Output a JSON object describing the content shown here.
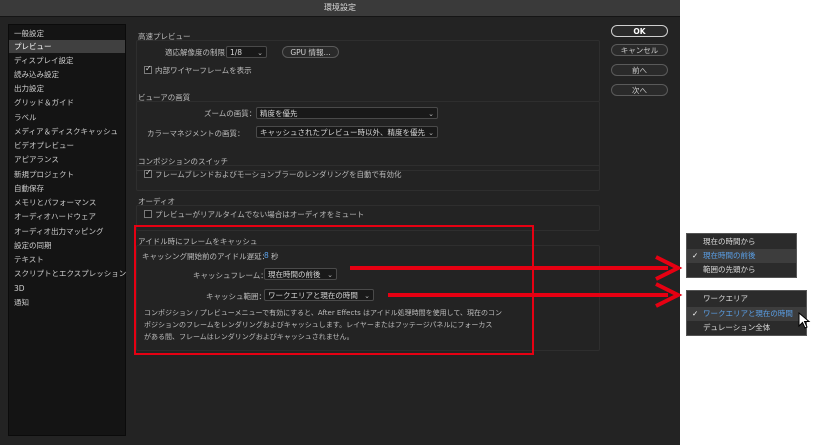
{
  "window": {
    "title": "環境設定"
  },
  "sidebar": {
    "items": [
      "一般設定",
      "プレビュー",
      "ディスプレイ設定",
      "読み込み設定",
      "出力設定",
      "グリッド＆ガイド",
      "ラベル",
      "メディア＆ディスクキャッシュ",
      "ビデオプレビュー",
      "アピアランス",
      "新規プロジェクト",
      "自動保存",
      "メモリとパフォーマンス",
      "オーディオハードウェア",
      "オーディオ出力マッピング",
      "設定の同期",
      "テキスト",
      "スクリプトとエクスプレッション",
      "3D",
      "通知"
    ],
    "selected": "プレビュー"
  },
  "buttons": {
    "ok": "OK",
    "cancel": "キャンセル",
    "prev": "前へ",
    "next": "次へ"
  },
  "fast_preview": {
    "title": "高速プレビュー",
    "res_label": "適応解像度の制限：",
    "res_value": "1/8",
    "gpu_button": "GPU 情報...",
    "wireframe_label": "内部ワイヤーフレームを表示"
  },
  "viewer_quality": {
    "title": "ビューアの画質",
    "zoom_label": "ズームの画質：",
    "zoom_value": "精度を優先",
    "color_label": "カラーマネジメントの画質：",
    "color_value": "キャッシュされたプレビュー時以外、精度を優先"
  },
  "comp_switch": {
    "title": "コンポジションのスイッチ",
    "label": "フレームブレンドおよびモーションブラーのレンダリングを自動で有効化"
  },
  "audio": {
    "title": "オーディオ",
    "label": "プレビューがリアルタイムでない場合はオーディオをミュート"
  },
  "idle_cache": {
    "title": "アイドル時にフレームをキャッシュ",
    "delay_label": "キャッシング開始前のアイドル遅延：",
    "delay_value": "8",
    "delay_unit": "秒",
    "frame_label": "キャッシュフレーム：",
    "frame_value": "現在時間の前後",
    "range_label": "キャッシュ範囲：",
    "range_value": "ワークエリアと現在の時間",
    "description": [
      "コンポジション / プレビューメニューで有効にすると、After Effects はアイドル処理時間を使用して、現在のコン",
      "ポジションのフレームをレンダリングおよびキャッシュします。レイヤーまたはフッテージパネルにフォーカス",
      "がある間、フレームはレンダリングおよびキャッシュされません。"
    ]
  },
  "frame_menu": {
    "options": [
      "現在の時間から",
      "現在時間の前後",
      "範囲の先頭から"
    ],
    "selected": "現在時間の前後"
  },
  "range_menu": {
    "options": [
      "ワークエリア",
      "ワークエリアと現在の時間",
      "デュレーション全体"
    ],
    "selected": "ワークエリアと現在の時間"
  },
  "colors": {
    "accent": "#5aa0e8",
    "annotation": "#e60012"
  }
}
